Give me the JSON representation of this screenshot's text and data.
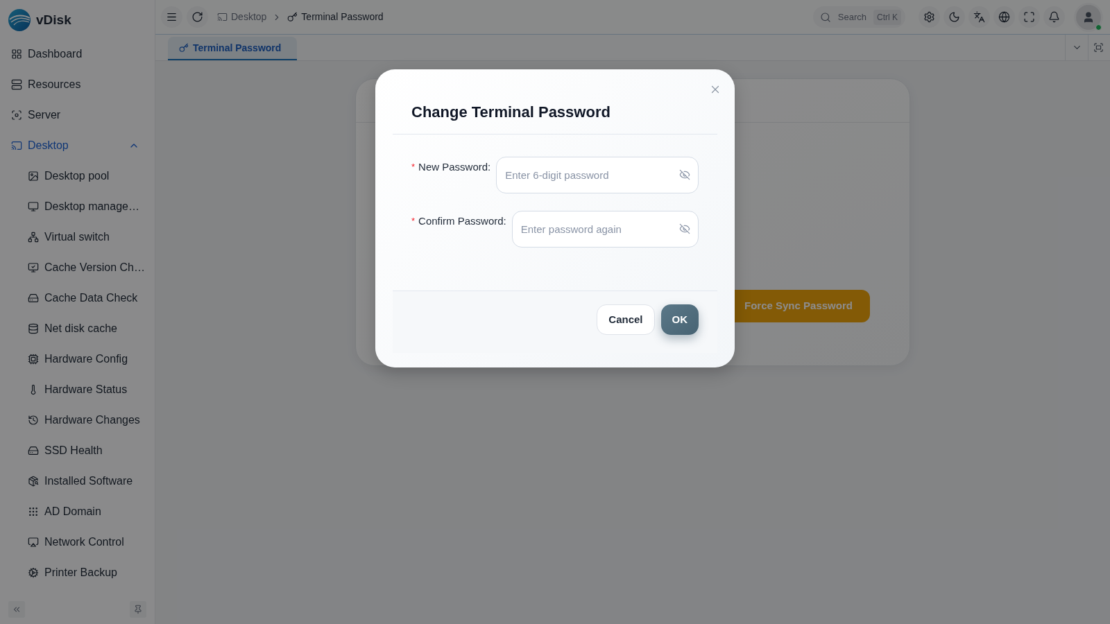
{
  "brand": {
    "name": "vDisk"
  },
  "sidebar": {
    "items": [
      {
        "label": "Dashboard",
        "selected": false
      },
      {
        "label": "Resources",
        "selected": false
      },
      {
        "label": "Server",
        "selected": false
      },
      {
        "label": "Desktop",
        "selected": true,
        "expanded": true,
        "children": [
          {
            "label": "Desktop pool",
            "selected": false
          },
          {
            "label": "Desktop manage…",
            "selected": false
          },
          {
            "label": "Virtual switch",
            "selected": false
          },
          {
            "label": "Cache Version Ch…",
            "selected": false
          },
          {
            "label": "Cache Data Check",
            "selected": false
          },
          {
            "label": "Net disk cache",
            "selected": false
          },
          {
            "label": "Hardware Config",
            "selected": false
          },
          {
            "label": "Hardware Status",
            "selected": false
          },
          {
            "label": "Hardware Changes",
            "selected": false
          },
          {
            "label": "SSD Health",
            "selected": false
          },
          {
            "label": "Installed Software",
            "selected": false
          },
          {
            "label": "AD Domain",
            "selected": false
          },
          {
            "label": "Network Control",
            "selected": false
          },
          {
            "label": "Printer Backup",
            "selected": false
          }
        ]
      }
    ]
  },
  "topbar": {
    "breadcrumb": [
      {
        "label": "Desktop"
      },
      {
        "label": "Terminal Password"
      }
    ],
    "search": {
      "label": "Search",
      "shortcut": "Ctrl K"
    },
    "user": {
      "online": true
    }
  },
  "tabs": [
    {
      "label": "Terminal Password",
      "selected": true
    }
  ],
  "page": {
    "action_button": {
      "label": "Force Sync Password"
    }
  },
  "dialog": {
    "title": "Change Terminal Password",
    "fields": [
      {
        "required_mark": "*",
        "label": "New Password:",
        "placeholder": "Enter 6-digit password"
      },
      {
        "required_mark": "*",
        "label": "Confirm Password:",
        "placeholder": "Enter password again"
      }
    ],
    "buttons": [
      {
        "label": "Cancel",
        "kind": "secondary"
      },
      {
        "label": "OK",
        "kind": "primary"
      }
    ]
  }
}
